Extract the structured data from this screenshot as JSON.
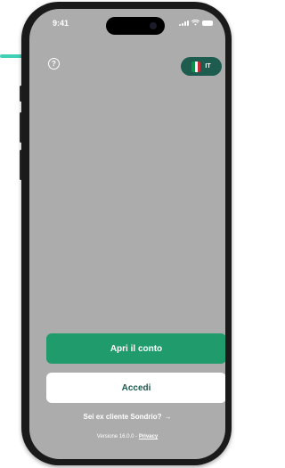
{
  "status_bar": {
    "time": "9:41"
  },
  "header": {
    "help_icon": "question-circle-icon",
    "language": {
      "code": "IT",
      "flag_icon": "italy-flag-icon",
      "flag_colors": [
        "#0b9246",
        "#ffffff",
        "#ce2b37"
      ]
    }
  },
  "actions": {
    "open_account_label": "Apri il conto",
    "login_label": "Accedi",
    "ex_client_label": "Sei ex cliente Sondrio?",
    "ex_client_arrow": "→"
  },
  "footer": {
    "version_text": "Versione 16.0.0 - ",
    "privacy_label": "Privacy"
  },
  "colors": {
    "primary": "#1f9b6c",
    "pill": "#1e5c50",
    "screen_bg": "#acacac",
    "accent_line": "#3fd1b8"
  }
}
